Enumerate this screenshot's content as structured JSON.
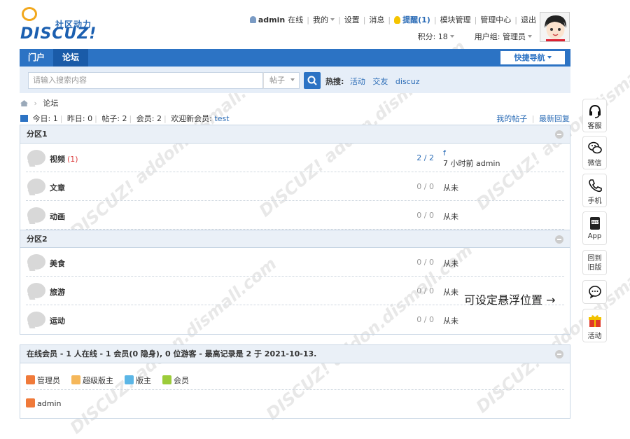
{
  "logo": {
    "slogan": "社区动力",
    "word": "DISCUZ!"
  },
  "topbar": {
    "username": "admin",
    "online": "在线",
    "mine": "我的",
    "settings": "设置",
    "messages": "消息",
    "remind": "提醒(1)",
    "module_manage": "模块管理",
    "admin_center": "管理中心",
    "logout": "退出"
  },
  "subbar": {
    "points": "积分: 18",
    "usergroup": "用户组: 管理员"
  },
  "nav": {
    "items": [
      {
        "label": "门户"
      },
      {
        "label": "论坛"
      }
    ],
    "quicknav": "快捷导航"
  },
  "search": {
    "placeholder": "请输入搜索内容",
    "type": "帖子",
    "hot_label": "热搜:",
    "hot": [
      "活动",
      "交友",
      "discuz"
    ]
  },
  "breadcrumb": {
    "current": "论坛"
  },
  "stats": {
    "today": "今日: 1",
    "yesterday": "昨日: 0",
    "posts": "帖子: 2",
    "members": "会员: 2",
    "welcome": "欢迎新会员: ",
    "newest": "test",
    "my_posts": "我的帖子",
    "latest": "最新回复"
  },
  "sections": [
    {
      "title": "分区1",
      "forums": [
        {
          "name": "视频",
          "new": "(1)",
          "count": "2 / 2",
          "last_line1": "f",
          "last_line2": "7 小时前 admin"
        },
        {
          "name": "文章",
          "count": "0 / 0",
          "last_line1": "从未"
        },
        {
          "name": "动画",
          "count": "0 / 0",
          "last_line1": "从未"
        }
      ]
    },
    {
      "title": "分区2",
      "forums": [
        {
          "name": "美食",
          "count": "0 / 0",
          "last_line1": "从未"
        },
        {
          "name": "旅游",
          "count": "0 / 0",
          "last_line1": "从未"
        },
        {
          "name": "运动",
          "count": "0 / 0",
          "last_line1": "从未"
        }
      ]
    }
  ],
  "online": {
    "title": "在线会员 - 1 人在线 - 1 会员(0 隐身), 0 位游客 - 最高记录是 2 于 2021-10-13.",
    "legend": [
      "管理员",
      "超级版主",
      "版主",
      "会员"
    ],
    "users": [
      "admin"
    ]
  },
  "float": {
    "items": [
      {
        "label": "客服",
        "icon": "headset-icon"
      },
      {
        "label": "微信",
        "icon": "wechat-icon"
      },
      {
        "label": "手机",
        "icon": "phone-icon"
      },
      {
        "label": "App",
        "icon": "app-icon"
      },
      {
        "label": "回到旧版",
        "icon": ""
      },
      {
        "label": "",
        "icon": "chat-icon"
      },
      {
        "label": "活动",
        "icon": "gift-icon"
      }
    ],
    "tip": "可设定悬浮位置 →"
  },
  "colors": {
    "brand": "#2c73c4",
    "nav_active": "#1a5ba8",
    "link": "#2b6cb6",
    "head_bg": "#eaf0f7"
  }
}
